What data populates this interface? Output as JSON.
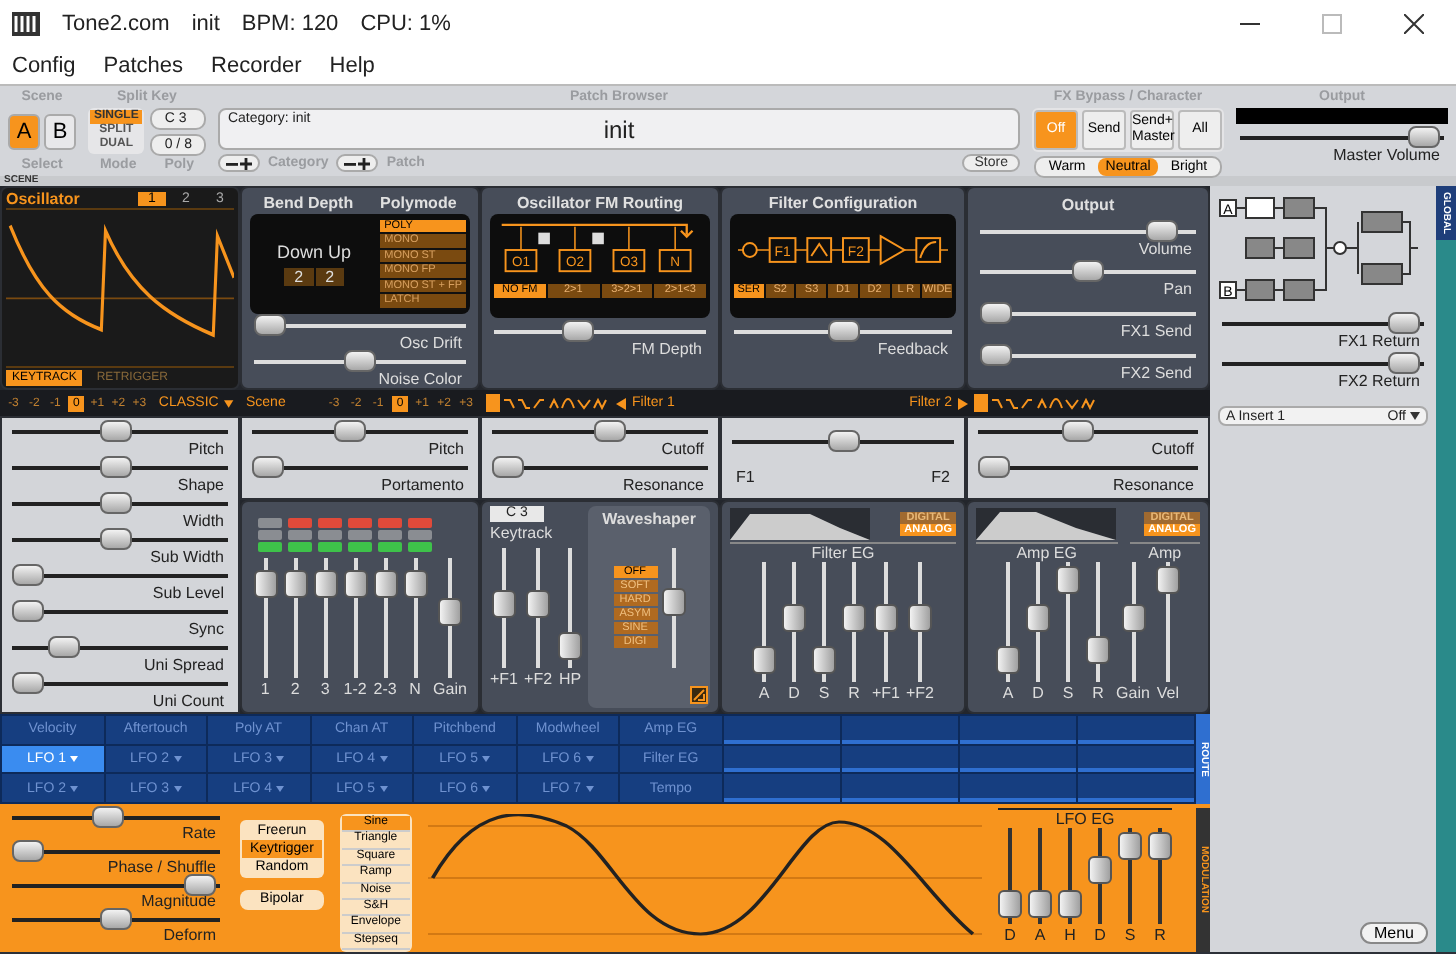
{
  "window": {
    "title": "Tone2.com",
    "patch": "init",
    "bpm": "BPM: 120",
    "cpu": "CPU: 1%"
  },
  "menu": [
    "Config",
    "Patches",
    "Recorder",
    "Help"
  ],
  "scene_select": {
    "title": "Scene",
    "caption": "Select",
    "buttons": [
      {
        "label": "A",
        "selected": true
      },
      {
        "label": "B",
        "selected": false
      }
    ]
  },
  "split_key": {
    "title": "Split Key",
    "mode_caption": "Mode",
    "modes": [
      {
        "label": "SINGLE",
        "selected": true
      },
      {
        "label": "SPLIT",
        "selected": false
      },
      {
        "label": "DUAL",
        "selected": false
      }
    ],
    "key": "C 3",
    "poly": "0 / 8",
    "poly_caption": "Poly"
  },
  "patch_browser": {
    "title": "Patch Browser",
    "category": "Category: init",
    "name": "init",
    "category_label": "Category",
    "patch_label": "Patch",
    "store": "Store"
  },
  "fx_bypass": {
    "title": "FX Bypass / Character",
    "bypass": [
      {
        "label": "Off",
        "selected": true
      },
      {
        "label": "Send",
        "selected": false
      },
      {
        "label": "Send+ Master",
        "selected": false
      },
      {
        "label": "All",
        "selected": false
      }
    ],
    "character": [
      {
        "label": "Warm",
        "selected": false
      },
      {
        "label": "Neutral",
        "selected": true
      },
      {
        "label": "Bright",
        "selected": false
      }
    ]
  },
  "output_master": {
    "title": "Output",
    "volume": {
      "label": "Master Volume",
      "level": 0.98
    }
  },
  "scene_strip_label": "SCENE",
  "edge_tab": "GLOBAL",
  "oscillator": {
    "title": "Oscillator",
    "tabs": [
      {
        "label": "1",
        "selected": true
      },
      {
        "label": "2",
        "selected": false
      },
      {
        "label": "3",
        "selected": false
      }
    ],
    "keytrack": {
      "label": "KEYTRACK",
      "on": true
    },
    "retrigger": {
      "label": "RETRIGGER",
      "on": false
    },
    "octave": [
      {
        "label": "-3",
        "selected": false
      },
      {
        "label": "-2",
        "selected": false
      },
      {
        "label": "-1",
        "selected": false
      },
      {
        "label": "0",
        "selected": true
      },
      {
        "label": "+1",
        "selected": false
      },
      {
        "label": "+2",
        "selected": false
      },
      {
        "label": "+3",
        "selected": false
      }
    ],
    "mode": "CLASSIC",
    "sliders": [
      {
        "label": "Pitch",
        "level": 0.48
      },
      {
        "label": "Shape",
        "level": 0.48
      },
      {
        "label": "Width",
        "level": 0.48
      },
      {
        "label": "Sub Width",
        "level": 0.48
      },
      {
        "label": "Sub Level",
        "level": 0
      },
      {
        "label": "Sync",
        "level": 0
      },
      {
        "label": "Uni Spread",
        "level": 0.2
      },
      {
        "label": "Uni Count",
        "level": 0
      }
    ]
  },
  "bend_poly": {
    "bend_title": "Bend Depth",
    "poly_title": "Polymode",
    "bend_label": "Down Up",
    "bend_values": [
      "2",
      "2"
    ],
    "polymodes": [
      {
        "label": "POLY",
        "selected": true
      },
      {
        "label": "MONO",
        "selected": false
      },
      {
        "label": "MONO ST",
        "selected": false
      },
      {
        "label": "MONO FP",
        "selected": false
      },
      {
        "label": "MONO ST + FP",
        "selected": false
      },
      {
        "label": "LATCH",
        "selected": false
      }
    ],
    "sliders": [
      {
        "label": "Osc Drift",
        "level": 0
      },
      {
        "label": "Noise Color",
        "level": 0.5
      }
    ]
  },
  "fm_routing": {
    "title": "Oscillator FM Routing",
    "nodes": [
      "O1",
      "O2",
      "O3",
      "N"
    ],
    "modes": [
      {
        "label": "NO FM",
        "selected": true
      },
      {
        "label": "2>1",
        "selected": false
      },
      {
        "label": "3>2>1",
        "selected": false
      },
      {
        "label": "2>1<3",
        "selected": false
      }
    ],
    "slider": {
      "label": "FM Depth",
      "level": 0.38
    }
  },
  "filter_config": {
    "title": "Filter Configuration",
    "nodes": [
      "F1",
      "F2"
    ],
    "modes": [
      {
        "label": "SER",
        "selected": true
      },
      {
        "label": "S2",
        "selected": false
      },
      {
        "label": "S3",
        "selected": false
      },
      {
        "label": "D1",
        "selected": false
      },
      {
        "label": "D2",
        "selected": false
      },
      {
        "label": "L R",
        "selected": false
      },
      {
        "label": "WIDE",
        "selected": false
      }
    ],
    "slider": {
      "label": "Feedback",
      "level": 0.5
    }
  },
  "output": {
    "title": "Output",
    "sliders": [
      {
        "label": "Volume",
        "level": 0.9
      },
      {
        "label": "Pan",
        "level": 0.5
      },
      {
        "label": "FX1 Send",
        "level": 0
      },
      {
        "label": "FX2 Send",
        "level": 0
      }
    ]
  },
  "scene": {
    "title": "Scene",
    "octave": [
      {
        "label": "-3",
        "selected": false
      },
      {
        "label": "-2",
        "selected": false
      },
      {
        "label": "-1",
        "selected": false
      },
      {
        "label": "0",
        "selected": true
      },
      {
        "label": "+1",
        "selected": false
      },
      {
        "label": "+2",
        "selected": false
      },
      {
        "label": "+3",
        "selected": false
      }
    ],
    "sliders": [
      {
        "label": "Pitch",
        "level": 0.45
      },
      {
        "label": "Portamento",
        "level": 0
      }
    ]
  },
  "filters": {
    "filter1_label": "Filter 1",
    "filter2_label": "Filter 2",
    "filter1_sliders": [
      {
        "label": "Cutoff",
        "level": 0.55
      },
      {
        "label": "Resonance",
        "level": 0
      }
    ],
    "balance": {
      "left": "F1",
      "right": "F2",
      "level": 0.5
    },
    "filter2_sliders": [
      {
        "label": "Cutoff",
        "level": 0.45
      },
      {
        "label": "Resonance",
        "level": 0
      }
    ]
  },
  "mixer": {
    "channels": [
      {
        "label": "1",
        "level": 0.85,
        "upper_on": false,
        "lower_on": false,
        "led_on": true
      },
      {
        "label": "2",
        "level": 0.85,
        "upper_on": true,
        "lower_on": false,
        "led_on": true
      },
      {
        "label": "3",
        "level": 0.85,
        "upper_on": true,
        "lower_on": false,
        "led_on": true
      },
      {
        "label": "1-2",
        "level": 0.85,
        "upper_on": true,
        "lower_on": false,
        "led_on": true
      },
      {
        "label": "2-3",
        "level": 0.85,
        "upper_on": true,
        "lower_on": false,
        "led_on": true
      },
      {
        "label": "N",
        "level": 0.85,
        "upper_on": true,
        "lower_on": false,
        "led_on": true
      }
    ],
    "gain": {
      "label": "Gain",
      "level": 0.55
    }
  },
  "keytrack": {
    "key": "C 3",
    "title": "Keytrack",
    "faders": [
      {
        "label": "+F1",
        "level": 0.55
      },
      {
        "label": "+F2",
        "level": 0.55
      },
      {
        "label": "HP",
        "level": 0.08
      }
    ]
  },
  "waveshaper": {
    "title": "Waveshaper",
    "types": [
      {
        "label": "OFF",
        "selected": true
      },
      {
        "label": "SOFT",
        "selected": false
      },
      {
        "label": "HARD",
        "selected": false
      },
      {
        "label": "ASYM",
        "selected": false
      },
      {
        "label": "SINE",
        "selected": false
      },
      {
        "label": "DIGI",
        "selected": false
      }
    ],
    "fader": {
      "level": 0.55
    },
    "checkbox": {
      "checked": true
    }
  },
  "filter_eg": {
    "title": "Filter EG",
    "models": [
      {
        "label": "DIGITAL",
        "selected": false
      },
      {
        "label": "ANALOG",
        "selected": true
      }
    ],
    "faders": [
      {
        "label": "A",
        "level": 0.08
      },
      {
        "label": "D",
        "level": 0.55
      },
      {
        "label": "S",
        "level": 0.08
      },
      {
        "label": "R",
        "level": 0.55
      },
      {
        "label": "+F1",
        "level": 0.55
      },
      {
        "label": "+F2",
        "level": 0.55
      }
    ]
  },
  "amp_eg": {
    "title": "Amp EG",
    "amp_title": "Amp",
    "models": [
      {
        "label": "DIGITAL",
        "selected": false
      },
      {
        "label": "ANALOG",
        "selected": true
      }
    ],
    "faders": [
      {
        "label": "A",
        "level": 0.08
      },
      {
        "label": "D",
        "level": 0.55
      },
      {
        "label": "S",
        "level": 0.95
      },
      {
        "label": "R",
        "level": 0.2
      },
      {
        "label": "Gain",
        "level": 0.55
      },
      {
        "label": "Vel",
        "level": 0.95
      }
    ]
  },
  "mod_routing": {
    "label": "ROUTE",
    "rows": [
      [
        {
          "label": "Velocity",
          "selected": false
        },
        {
          "label": "Aftertouch",
          "selected": false
        },
        {
          "label": "Poly AT",
          "selected": false
        },
        {
          "label": "Chan AT",
          "selected": false
        },
        {
          "label": "Pitchbend",
          "selected": false
        },
        {
          "label": "Modwheel",
          "selected": false
        },
        {
          "label": "Amp EG",
          "selected": false
        }
      ],
      [
        {
          "label": "LFO 1",
          "selected": true
        },
        {
          "label": "LFO 2",
          "selected": false
        },
        {
          "label": "LFO 3",
          "selected": false
        },
        {
          "label": "LFO 4",
          "selected": false
        },
        {
          "label": "LFO 5",
          "selected": false
        },
        {
          "label": "LFO 6",
          "selected": false
        },
        {
          "label": "Filter EG",
          "selected": false
        }
      ],
      [
        {
          "label": "LFO 2",
          "selected": false
        },
        {
          "label": "LFO 3",
          "selected": false
        },
        {
          "label": "LFO 4",
          "selected": false
        },
        {
          "label": "LFO 5",
          "selected": false
        },
        {
          "label": "LFO 6",
          "selected": false
        },
        {
          "label": "LFO 7",
          "selected": false
        },
        {
          "label": "Tempo",
          "selected": false
        }
      ]
    ]
  },
  "lfo": {
    "label": "MODULATION",
    "sliders": [
      {
        "label": "Rate",
        "level": 0.45
      },
      {
        "label": "Phase / Shuffle",
        "level": 0
      },
      {
        "label": "Magnitude",
        "level": 0.98
      },
      {
        "label": "Deform",
        "level": 0.5
      }
    ],
    "triggers": [
      {
        "label": "Freerun",
        "selected": false
      },
      {
        "label": "Keytrigger",
        "selected": true
      },
      {
        "label": "Random",
        "selected": false
      }
    ],
    "bipolar": "Bipolar",
    "shapes": [
      {
        "label": "Sine",
        "selected": true
      },
      {
        "label": "Triangle",
        "selected": false
      },
      {
        "label": "Square",
        "selected": false
      },
      {
        "label": "Ramp",
        "selected": false
      },
      {
        "label": "Noise",
        "selected": false
      },
      {
        "label": "S&H",
        "selected": false
      },
      {
        "label": "Envelope",
        "selected": false
      },
      {
        "label": "Stepseq",
        "selected": false
      }
    ],
    "eg_title": "LFO EG",
    "eg_faders": [
      {
        "label": "D",
        "level": 0.1
      },
      {
        "label": "A",
        "level": 0.1
      },
      {
        "label": "H",
        "level": 0.1
      },
      {
        "label": "D",
        "level": 0.6
      },
      {
        "label": "S",
        "level": 0.95
      },
      {
        "label": "R",
        "level": 0.95
      }
    ]
  },
  "sidebar": {
    "fx_inputs": [
      "A",
      "B"
    ],
    "fx1_return": {
      "label": "FX1 Return",
      "level": 0.98
    },
    "fx2_return": {
      "label": "FX2 Return",
      "level": 0.98
    },
    "insert": {
      "label": "A Insert 1",
      "value": "Off"
    },
    "menu": "Menu"
  }
}
